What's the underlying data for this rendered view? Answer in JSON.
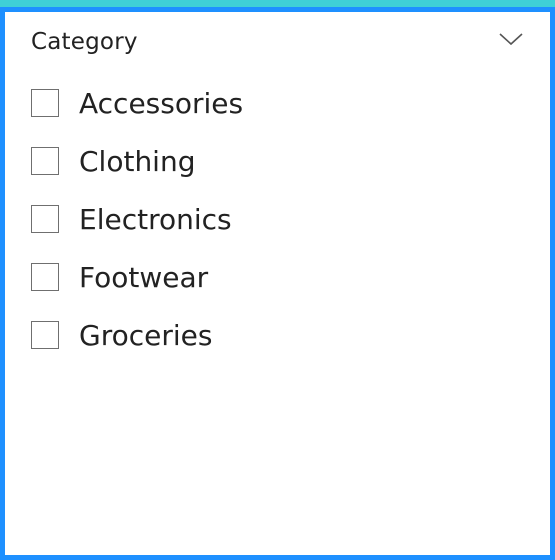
{
  "slicer": {
    "title": "Category",
    "expand_icon": "chevron-down-icon",
    "items": [
      {
        "label": "Accessories",
        "checked": false
      },
      {
        "label": "Clothing",
        "checked": false
      },
      {
        "label": "Electronics",
        "checked": false
      },
      {
        "label": "Footwear",
        "checked": false
      },
      {
        "label": "Groceries",
        "checked": false
      }
    ]
  },
  "colors": {
    "accent_border": "#1e90ff",
    "top_strip": "#3fd0d6",
    "text": "#222222",
    "checkbox_border": "#6f6f6f"
  }
}
